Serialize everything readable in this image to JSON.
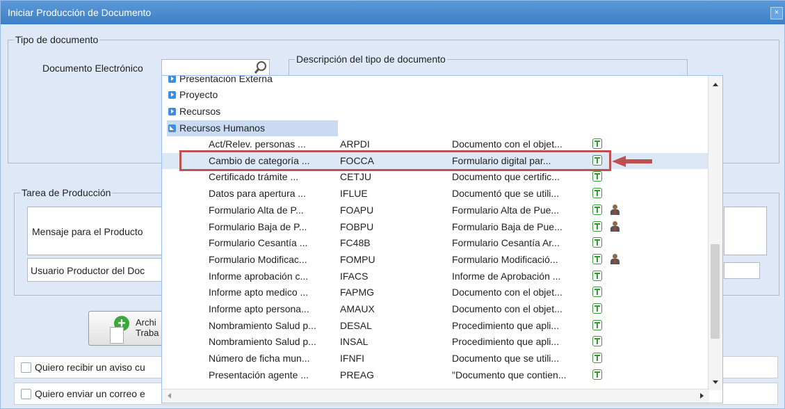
{
  "window": {
    "title": "Iniciar Producción de Documento",
    "close": "×"
  },
  "tipo": {
    "legend": "Tipo de documento",
    "doc_label": "Documento Electrónico",
    "desc_legend": "Descripción del tipo de documento"
  },
  "tarea": {
    "legend": "Tarea de Producción",
    "mensaje_label": "Mensaje para el Producto",
    "usuario_label": "Usuario Productor del Doc"
  },
  "archivo_button": {
    "line1": "Archi",
    "line2": "Traba"
  },
  "checks": {
    "aviso": "Quiero recibir un aviso cu",
    "correo": "Quiero enviar un correo e"
  },
  "dropdown": {
    "groups": [
      {
        "label": "Presentación Externa",
        "open": false
      },
      {
        "label": "Proyecto",
        "open": false
      },
      {
        "label": "Recursos",
        "open": false
      },
      {
        "label": "Recursos Humanos",
        "open": true
      }
    ],
    "rows": [
      {
        "name": "Act/Relev. personas ...",
        "code": "ARPDI",
        "desc": "Documento con el objet...",
        "person": false
      },
      {
        "name": "Cambio de categoría ...",
        "code": "FOCCA",
        "desc": "Formulario digital par...",
        "person": false
      },
      {
        "name": "Certificado trámite ...",
        "code": "CETJU",
        "desc": "Documento que certific...",
        "person": false
      },
      {
        "name": "Datos para apertura ...",
        "code": "IFLUE",
        "desc": "Documentó que se utili...",
        "person": false
      },
      {
        "name": "Formulario Alta de P...",
        "code": "FOAPU",
        "desc": "Formulario Alta de Pue...",
        "person": true
      },
      {
        "name": "Formulario Baja de P...",
        "code": "FOBPU",
        "desc": "Formulario Baja de Pue...",
        "person": true
      },
      {
        "name": "Formulario Cesantía ...",
        "code": "FC48B",
        "desc": "Formulario Cesantía Ar...",
        "person": false
      },
      {
        "name": "Formulario Modificac...",
        "code": "FOMPU",
        "desc": "Formulario Modificació...",
        "person": true
      },
      {
        "name": "Informe aprobación c...",
        "code": "IFACS",
        "desc": "Informe de Aprobación ...",
        "person": false
      },
      {
        "name": "Informe apto medico ...",
        "code": "FAPMG",
        "desc": "Documento con el objet...",
        "person": false
      },
      {
        "name": "Informe apto persona...",
        "code": "AMAUX",
        "desc": "Documento con el objet...",
        "person": false
      },
      {
        "name": "Nombramiento Salud p...",
        "code": "DESAL",
        "desc": "Procedimiento que apli...",
        "person": false
      },
      {
        "name": "Nombramiento Salud p...",
        "code": "INSAL",
        "desc": "Procedimiento que apli...",
        "person": false
      },
      {
        "name": "Número de ficha mun...",
        "code": "IFNFI",
        "desc": "Documento que se utili...",
        "person": false
      },
      {
        "name": "Presentación agente ...",
        "code": "PREAG",
        "desc": "\"Documento que contien...",
        "person": false
      }
    ],
    "selected_index": 1
  },
  "colors": {
    "accent": "#3d7fc5",
    "highlight_box": "#c0504d",
    "selected_row": "#dde8f6"
  }
}
